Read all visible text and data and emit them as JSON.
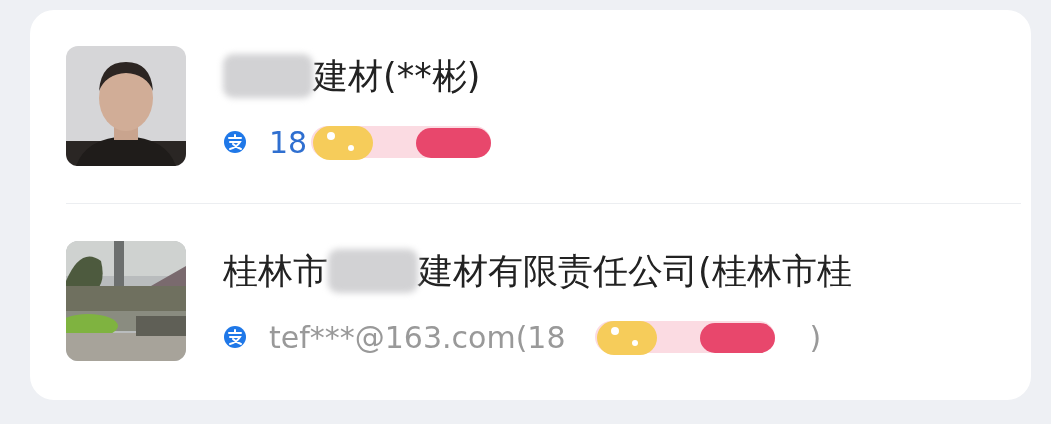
{
  "contacts": [
    {
      "avatar": {
        "kind": "picture"
      },
      "name": [
        {
          "kind": "redacted"
        },
        {
          "kind": "text",
          "text": "建材(**彬)"
        }
      ],
      "account": [
        {
          "kind": "text",
          "text": "18"
        },
        {
          "kind": "sticker"
        }
      ]
    },
    {
      "avatar": {
        "kind": "picture"
      },
      "name": [
        {
          "kind": "text",
          "text": "桂林市"
        },
        {
          "kind": "redacted"
        },
        {
          "kind": "text",
          "text": "建材有限责任公司(桂林市桂"
        }
      ],
      "account": [
        {
          "kind": "text",
          "text": "tef***@163.com(18"
        },
        {
          "kind": "sticker"
        },
        {
          "kind": "text",
          "text": ")"
        }
      ]
    }
  ]
}
